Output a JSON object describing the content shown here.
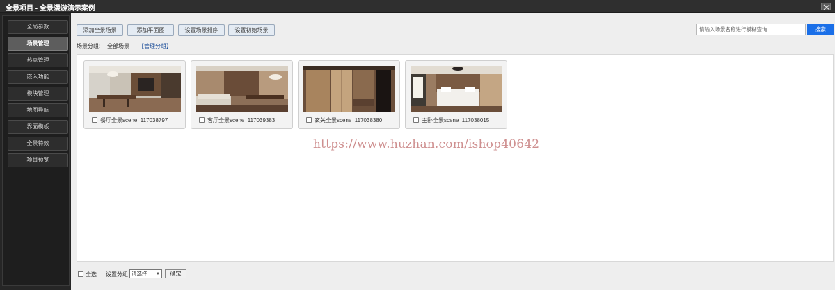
{
  "window": {
    "title": "全景项目 - 全景漫游演示案例"
  },
  "sidebar": {
    "items": [
      {
        "label": "全局参数",
        "active": false
      },
      {
        "label": "场景管理",
        "active": true
      },
      {
        "label": "热点管理",
        "active": false
      },
      {
        "label": "嵌入功能",
        "active": false
      },
      {
        "label": "模块管理",
        "active": false
      },
      {
        "label": "地图导航",
        "active": false
      },
      {
        "label": "界面模板",
        "active": false
      },
      {
        "label": "全景特效",
        "active": false
      },
      {
        "label": "项目预览",
        "active": false
      }
    ]
  },
  "toolbar": {
    "add_scene": "添加全景场景",
    "add_floorplan": "添加平面图",
    "sort_scenes": "设置场景排序",
    "initial_scene": "设置初始场景",
    "search_placeholder": "请输入场景名称进行模糊查询",
    "search_button": "搜索"
  },
  "group": {
    "label": "场景分组:",
    "current": "全部场景",
    "manage": "【管理分组】"
  },
  "scenes": [
    {
      "name": "餐厅全景scene_117038797",
      "thumb": "dining"
    },
    {
      "name": "客厅全景scene_117039383",
      "thumb": "living"
    },
    {
      "name": "玄关全景scene_117038380",
      "thumb": "entry"
    },
    {
      "name": "主卧全景scene_117038015",
      "thumb": "bedroom"
    }
  ],
  "footer": {
    "select_all": "全选",
    "set_group": "设置分组",
    "select_value": "请选择...",
    "confirm": "确定"
  },
  "watermark": "https://www.huzhan.com/ishop40642",
  "colors": {
    "accent": "#1a6fe8",
    "sidebar_bg": "#1e1e1e",
    "watermark": "#c98383"
  }
}
